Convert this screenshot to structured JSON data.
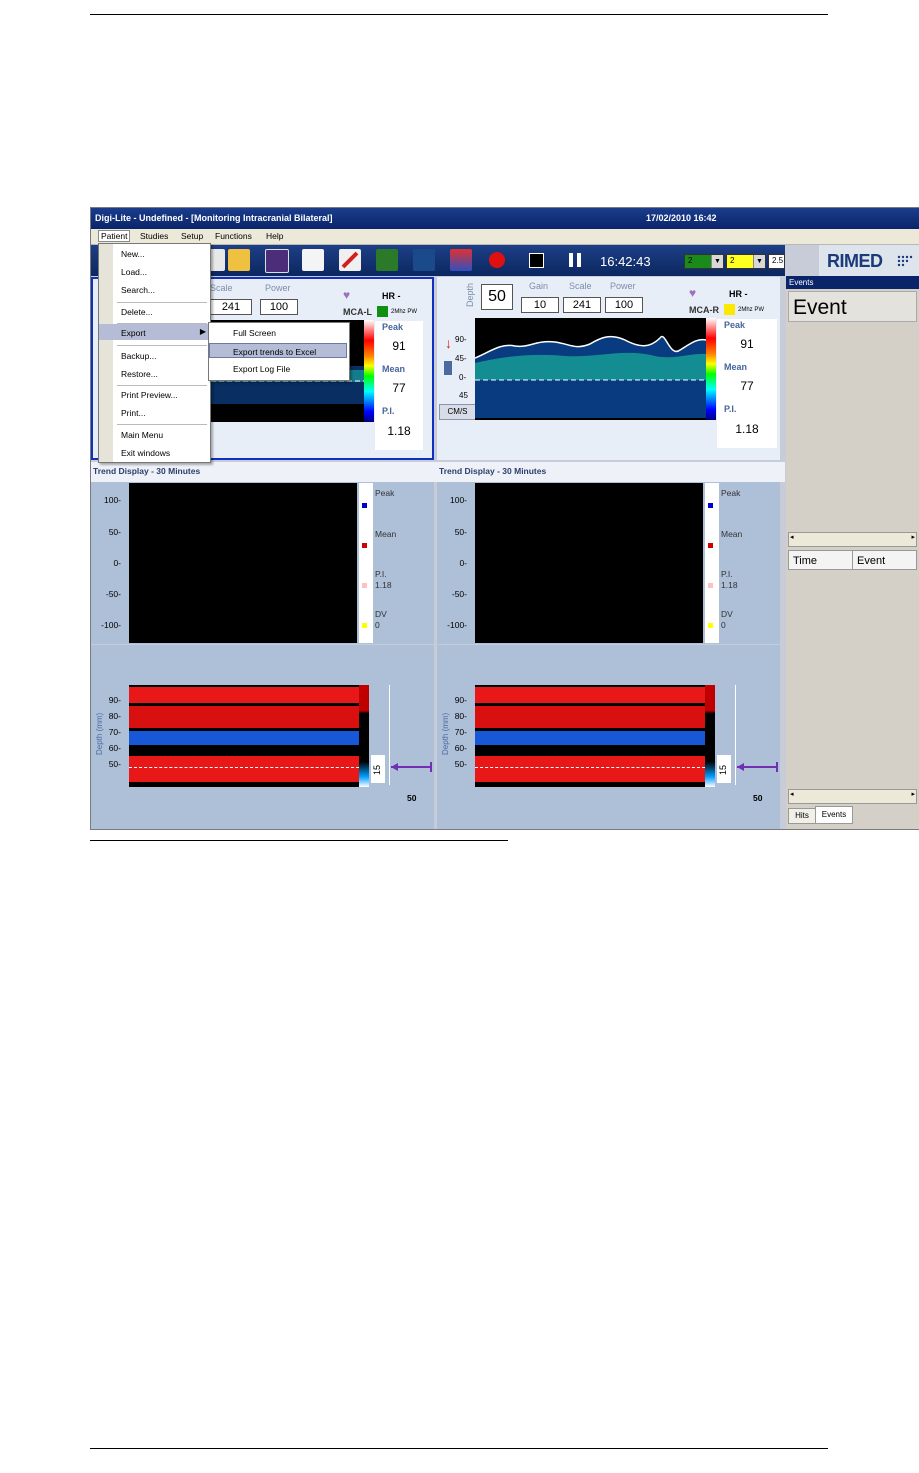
{
  "window": {
    "title": "Digi-Lite - Undefined - [Monitoring Intracranial Bilateral]",
    "datetime": "17/02/2010 16:42"
  },
  "menubar": {
    "items": [
      "Patient",
      "Studies",
      "Setup",
      "Functions",
      "Help"
    ]
  },
  "patient_menu": {
    "items": [
      "New...",
      "Load...",
      "Search...",
      "Delete...",
      "Export",
      "Backup...",
      "Restore...",
      "Print Preview...",
      "Print...",
      "Main Menu",
      "Exit windows"
    ]
  },
  "export_submenu": {
    "items": [
      "Full Screen",
      "Export trends to Excel",
      "Export Log File"
    ]
  },
  "toolbar": {
    "clock": "16:42:43",
    "combo1": "2",
    "combo2": "2",
    "combo3": "2.5",
    "logo": "RIMED"
  },
  "left_probe": {
    "scale_label": "Scale",
    "power_label": "Power",
    "scale": "241",
    "power": "100",
    "hr": "HR -",
    "vessel": "MCA-L",
    "probe": "2Mhz PW",
    "peak_label": "Peak",
    "peak": "91",
    "mean_label": "Mean",
    "mean": "77",
    "pi_label": "P.I.",
    "pi": "1.18"
  },
  "right_probe": {
    "depth_label": "Depth",
    "depth": "50",
    "gain_label": "Gain",
    "scale_label": "Scale",
    "power_label": "Power",
    "gain": "10",
    "scale": "241",
    "power": "100",
    "hr": "HR -",
    "vessel": "MCA-R",
    "probe": "2Mhz PW",
    "peak_label": "Peak",
    "peak": "91",
    "mean_label": "Mean",
    "mean": "77",
    "pi_label": "P.I.",
    "pi": "1.18",
    "axis": [
      "90-",
      "45-",
      "0-",
      "45"
    ],
    "units": "CM/S"
  },
  "trend": {
    "title": "Trend Display - 30 Minutes",
    "yticks": [
      "100-",
      "50-",
      "0-",
      "-50-",
      "-100-"
    ],
    "legend": {
      "peak": "Peak",
      "mean": "Mean",
      "pi": "P.I.",
      "pi_val": "1.18",
      "dv": "DV",
      "dv_val": "0"
    },
    "colors": {
      "peak": "#0000d0",
      "mean": "#d00000",
      "pi": "#ffc0c0",
      "dv": "#ffff00"
    }
  },
  "mmode": {
    "ylabel": "Depth (mm)",
    "yticks": [
      "90-",
      "80-",
      "70-",
      "60-",
      "50-"
    ],
    "gate": "15",
    "depth": "50"
  },
  "events_panel": {
    "title": "Events",
    "header": "Event",
    "col_time": "Time",
    "col_event": "Event",
    "tab_hits": "Hits",
    "tab_events": "Events"
  }
}
